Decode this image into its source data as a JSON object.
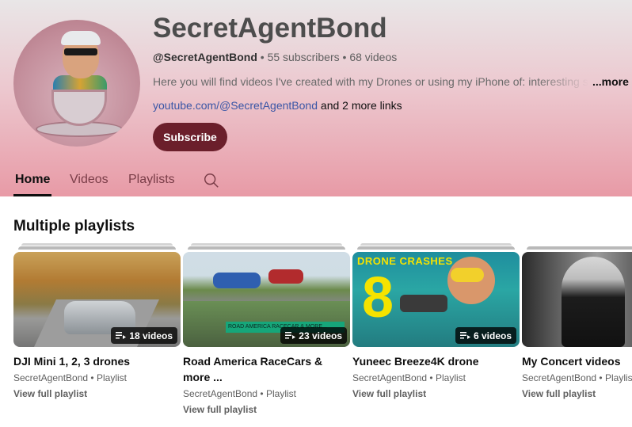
{
  "channel": {
    "name": "SecretAgentBond",
    "handle": "@SecretAgentBond",
    "subscribers": "55 subscribers",
    "videos": "68 videos",
    "description": "Here you will find videos I've created with my Drones or using my iPhone of: interesting st",
    "more_label": "...more",
    "link_url": "youtube.com/@SecretAgentBond",
    "more_links": "and 2 more links",
    "subscribe_label": "Subscribe",
    "meta_separator": "•"
  },
  "tabs": [
    {
      "label": "Home",
      "active": true
    },
    {
      "label": "Videos",
      "active": false
    },
    {
      "label": "Playlists",
      "active": false
    }
  ],
  "icons": {
    "search": "search-icon",
    "playlist": "playlist-icon"
  },
  "section": {
    "title": "Multiple playlists"
  },
  "playlists": [
    {
      "title": "DJI Mini 1, 2, 3 drones",
      "title_line2": "",
      "count": "18 videos",
      "owner": "SecretAgentBond",
      "type": "Playlist",
      "link": "View full playlist"
    },
    {
      "title": "Road America RaceCars &",
      "title_line2": "more ...",
      "count": "23 videos",
      "owner": "SecretAgentBond",
      "type": "Playlist",
      "link": "View full playlist",
      "thumb_text": "ROAD AMERICA RACECAR & MORE..."
    },
    {
      "title": "Yuneec Breeze4K drone",
      "title_line2": "",
      "count": "6 videos",
      "owner": "SecretAgentBond",
      "type": "Playlist",
      "link": "View full playlist",
      "thumb_title": "DRONE CRASHES",
      "thumb_number": "8"
    },
    {
      "title": "My Concert videos",
      "title_line2": "",
      "count": "",
      "owner": "SecretAgentBond",
      "type": "Playlis",
      "link": "View full playlist"
    }
  ],
  "colors": {
    "subscribe_bg": "#6b1f2b",
    "link": "#3a56a6",
    "header_top": "#e9e6e7",
    "header_bottom": "#e89aa6"
  }
}
